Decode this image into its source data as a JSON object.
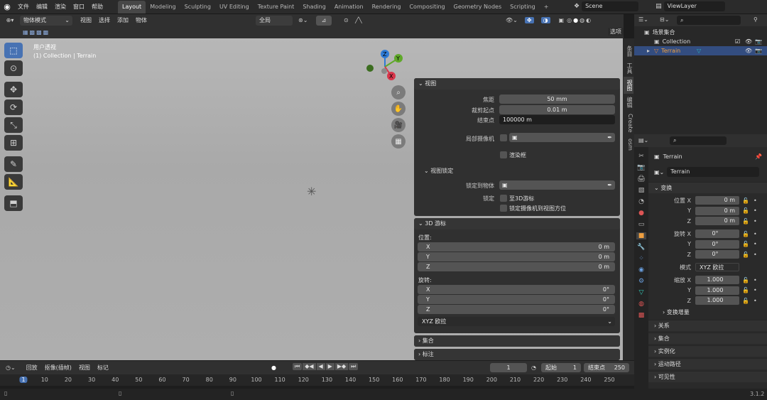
{
  "topbar": {
    "menus": [
      "文件",
      "编辑",
      "渲染",
      "窗口",
      "帮助"
    ],
    "workspaces": [
      "Layout",
      "Modeling",
      "Sculpting",
      "UV Editing",
      "Texture Paint",
      "Shading",
      "Animation",
      "Rendering",
      "Compositing",
      "Geometry Nodes",
      "Scripting"
    ],
    "active_workspace": "Layout",
    "add_tab": "+",
    "scene": "Scene",
    "view_layer": "ViewLayer"
  },
  "viewport_header": {
    "mode": "物体模式",
    "menus": [
      "视图",
      "选择",
      "添加",
      "物体"
    ],
    "transform_orientation": "全局",
    "options": "选项"
  },
  "viewport": {
    "view_name": "用户透视",
    "collection_path": "(1) Collection | Terrain"
  },
  "npanel": {
    "view": {
      "title": "视图",
      "focal_label": "焦距",
      "focal_value": "50 mm",
      "clip_start_label": "裁剪起点",
      "clip_start_value": "0.01 m",
      "clip_end_label": "结束点",
      "clip_end_value": "100000 m",
      "local_camera_label": "局部摄像机",
      "render_region_label": "渲染框",
      "view_lock_title": "视图锁定",
      "lock_to_object_label": "锁定到物体",
      "lock_label": "锁定",
      "to_3d_cursor_label": "至3D游标",
      "lock_camera_label": "锁定摄像机到视图方位"
    },
    "cursor": {
      "title": "3D 游标",
      "location_label": "位置:",
      "x_label": "X",
      "y_label": "Y",
      "z_label": "Z",
      "x_value": "0 m",
      "y_value": "0 m",
      "z_value": "0 m",
      "rotation_label": "旋转:",
      "rx_value": "0°",
      "ry_value": "0°",
      "rz_value": "0°",
      "rotation_mode": "XYZ 欧拉"
    },
    "collection_title": "集合",
    "annotation_title": "标注"
  },
  "sidebar_tabs": [
    "条目",
    "工具",
    "视图",
    "编辑",
    "Create",
    "osm"
  ],
  "active_sidebar_tab": "视图",
  "outliner": {
    "search_placeholder": "",
    "scene_collection": "场景集合",
    "collection": "Collection",
    "terrain": "Terrain"
  },
  "properties": {
    "object_name": "Terrain",
    "object_field": "Terrain",
    "transform_title": "变换",
    "location_label": "位置 X",
    "loc": [
      "0 m",
      "0 m",
      "0 m"
    ],
    "rotation_label": "旋转 X",
    "rot": [
      "0°",
      "0°",
      "0°"
    ],
    "mode_label": "模式",
    "mode_value": "XYZ 欧拉",
    "scale_label": "缩放 X",
    "scale": [
      "1.000",
      "1.000",
      "1.000"
    ],
    "y_label": "Y",
    "z_label": "Z",
    "delta_title": "变换增量",
    "sections": [
      "关系",
      "集合",
      "实例化",
      "运动路径",
      "可见性"
    ]
  },
  "timeline": {
    "playback": "回放",
    "keying": "抠像(插帧)",
    "view": "视图",
    "marker": "标记",
    "current_frame": "1",
    "start_label": "起始",
    "start_value": "1",
    "end_label": "结束点",
    "end_value": "250",
    "ruler": [
      "1",
      "10",
      "20",
      "30",
      "40",
      "50",
      "60",
      "70",
      "80",
      "90",
      "100",
      "110",
      "120",
      "130",
      "140",
      "150",
      "160",
      "170",
      "180",
      "190",
      "200",
      "210",
      "220",
      "230",
      "240",
      "250"
    ]
  },
  "status": {
    "version": "3.1.2"
  },
  "colors": {
    "accent": "#4772b3",
    "terrain_icon": "#e98a35",
    "terrain_mesh": "#2bb8c0"
  }
}
